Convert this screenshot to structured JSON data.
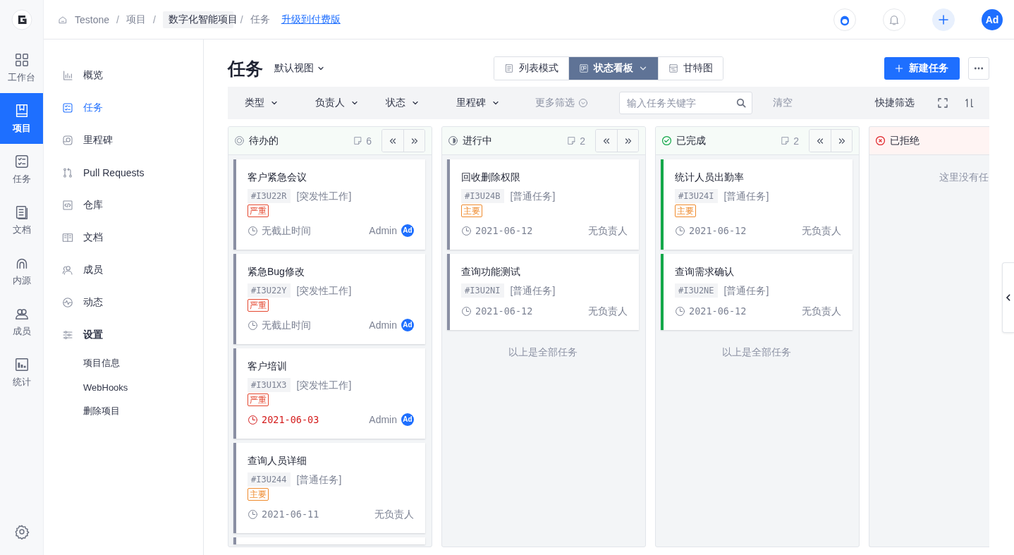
{
  "topbar": {
    "breadcrumb": [
      {
        "text": "Testone",
        "kind": "home"
      },
      {
        "text": "项目",
        "kind": "plain"
      },
      {
        "text": "数字化智能项目",
        "kind": "dropdown"
      },
      {
        "text": "任务",
        "kind": "plain"
      }
    ],
    "separator": "/",
    "upgrade_link": "升级到付费版",
    "avatar": "Ad"
  },
  "rail": {
    "items": [
      {
        "label": "工作台",
        "selected": false
      },
      {
        "label": "项目",
        "selected": true
      },
      {
        "label": "任务",
        "selected": false
      },
      {
        "label": "文档",
        "selected": false
      },
      {
        "label": "内源",
        "selected": false
      },
      {
        "label": "成员",
        "selected": false
      },
      {
        "label": "统计",
        "selected": false
      }
    ]
  },
  "sidebar": {
    "items": [
      {
        "label": "概览",
        "selected": false
      },
      {
        "label": "任务",
        "selected": true
      },
      {
        "label": "里程碑",
        "selected": false
      },
      {
        "label": "Pull Requests",
        "selected": false
      },
      {
        "label": "仓库",
        "selected": false
      },
      {
        "label": "文档",
        "selected": false
      },
      {
        "label": "成员",
        "selected": false
      },
      {
        "label": "动态",
        "selected": false
      },
      {
        "label": "设置",
        "selected": false,
        "children": [
          {
            "label": "项目信息"
          },
          {
            "label": "WebHooks"
          },
          {
            "label": "删除项目"
          }
        ]
      }
    ]
  },
  "page": {
    "title": "任务",
    "view": "默认视图",
    "view_modes": [
      {
        "label": "列表模式",
        "selected": false
      },
      {
        "label": "状态看板",
        "selected": true
      },
      {
        "label": "甘特图",
        "selected": false
      }
    ],
    "new_button": "新建任务"
  },
  "filters": {
    "dropdowns": [
      "类型",
      "负责人",
      "状态",
      "里程碑"
    ],
    "more": "更多筛选",
    "search": {
      "placeholder": "输入任务关键字"
    },
    "clear": "清空",
    "quick": "快捷筛选"
  },
  "columns": [
    {
      "title": "待办的",
      "kind": "todo",
      "count": "6",
      "more_below": true,
      "cards": [
        {
          "title": "客户紧急会议",
          "id": "#I3U22R",
          "type": "[突发性工作]",
          "tag": {
            "text": "严重",
            "color": "#e4472f"
          },
          "due": {
            "text": "无截止时间",
            "kind": "none"
          },
          "assignee": {
            "name": "Admin",
            "avatar": "Ad"
          }
        },
        {
          "title": "紧急Bug修改",
          "id": "#I3U22Y",
          "type": "[突发性工作]",
          "tag": {
            "text": "严重",
            "color": "#e4472f"
          },
          "due": {
            "text": "无截止时间",
            "kind": "none"
          },
          "assignee": {
            "name": "Admin",
            "avatar": "Ad"
          }
        },
        {
          "title": "客户培训",
          "id": "#I3U1X3",
          "type": "[突发性工作]",
          "tag": {
            "text": "严重",
            "color": "#e4472f"
          },
          "due": {
            "text": "2021-06-03",
            "kind": "overdue"
          },
          "assignee": {
            "name": "Admin",
            "avatar": "Ad"
          }
        },
        {
          "title": "查询人员详细",
          "id": "#I3U244",
          "type": "[普通任务]",
          "tag": {
            "text": "主要",
            "color": "#ef8a2c"
          },
          "due": {
            "text": "2021-06-11",
            "kind": "date"
          },
          "assignee": {
            "name": "无负责人"
          }
        }
      ]
    },
    {
      "title": "进行中",
      "kind": "progress",
      "count": "2",
      "footer": "以上是全部任务",
      "cards": [
        {
          "title": "回收删除权限",
          "id": "#I3U24B",
          "type": "[普通任务]",
          "tag": {
            "text": "主要",
            "color": "#ef8a2c"
          },
          "due": {
            "text": "2021-06-12",
            "kind": "date"
          },
          "assignee": {
            "name": "无负责人"
          }
        },
        {
          "title": "查询功能测试",
          "id": "#I3U2NI",
          "type": "[普通任务]",
          "due": {
            "text": "2021-06-12",
            "kind": "date"
          },
          "assignee": {
            "name": "无负责人"
          }
        }
      ]
    },
    {
      "title": "已完成",
      "kind": "done",
      "count": "2",
      "footer": "以上是全部任务",
      "cards": [
        {
          "title": "统计人员出勤率",
          "id": "#I3U24I",
          "type": "[普通任务]",
          "tag": {
            "text": "主要",
            "color": "#ef8a2c"
          },
          "due": {
            "text": "2021-06-12",
            "kind": "date"
          },
          "assignee": {
            "name": "无负责人"
          }
        },
        {
          "title": "查询需求确认",
          "id": "#I3U2NE",
          "type": "[普通任务]",
          "due": {
            "text": "2021-06-12",
            "kind": "date"
          },
          "assignee": {
            "name": "无负责人"
          }
        }
      ]
    },
    {
      "title": "已拒绝",
      "kind": "rejected",
      "empty_text": "这里没有任"
    }
  ]
}
